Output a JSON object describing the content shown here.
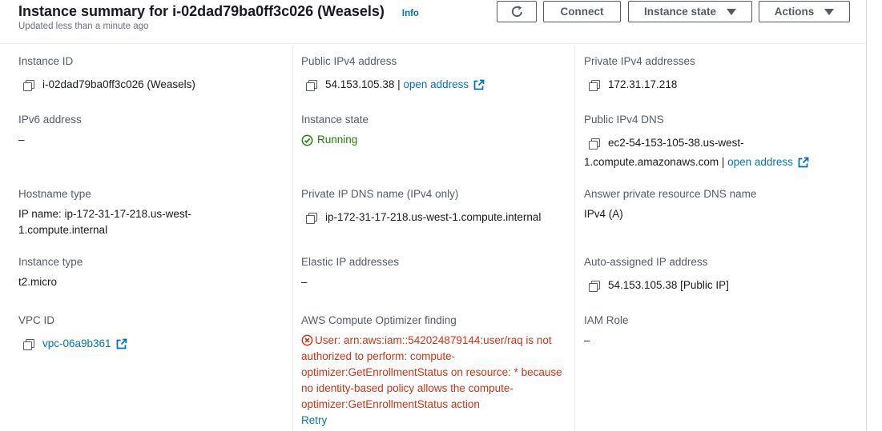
{
  "header": {
    "title": "Instance summary for i-02dad79ba0ff3c026 (Weasels)",
    "info": "Info",
    "subtitle": "Updated less than a minute ago",
    "buttons": {
      "connect": "Connect",
      "instance_state": "Instance state",
      "actions": "Actions"
    }
  },
  "fields": {
    "instance_id": {
      "label": "Instance ID",
      "value": "i-02dad79ba0ff3c026 (Weasels)"
    },
    "public_ipv4": {
      "label": "Public IPv4 address",
      "value": "54.153.105.38",
      "separator": " | ",
      "link": "open address"
    },
    "private_ipv4": {
      "label": "Private IPv4 addresses",
      "value": "172.31.17.218"
    },
    "ipv6": {
      "label": "IPv6 address",
      "value": "–"
    },
    "instance_state": {
      "label": "Instance state",
      "value": "Running"
    },
    "public_dns": {
      "label": "Public IPv4 DNS",
      "value_line1": "ec2-54-153-105-38.us-west-",
      "value_line2": "1.compute.amazonaws.com",
      "separator": " | ",
      "link": "open address"
    },
    "hostname_type": {
      "label": "Hostname type",
      "value": "IP name: ip-172-31-17-218.us-west-1.compute.internal"
    },
    "private_dns": {
      "label": "Private IP DNS name (IPv4 only)",
      "value": "ip-172-31-17-218.us-west-1.compute.internal"
    },
    "answer_dns": {
      "label": "Answer private resource DNS name",
      "value": "IPv4 (A)"
    },
    "instance_type": {
      "label": "Instance type",
      "value": "t2.micro"
    },
    "elastic_ip": {
      "label": "Elastic IP addresses",
      "value": "–"
    },
    "auto_ip": {
      "label": "Auto-assigned IP address",
      "value": "54.153.105.38 [Public IP]"
    },
    "vpc_id": {
      "label": "VPC ID",
      "value": "vpc-06a9b361"
    },
    "optimizer": {
      "label": "AWS Compute Optimizer finding",
      "error": "User: arn:aws:iam::542024879144:user/raq is not authorized to perform: compute-optimizer:GetEnrollmentStatus on resource: * because no identity-based policy allows the compute-optimizer:GetEnrollmentStatus action",
      "retry": "Retry"
    },
    "iam_role": {
      "label": "IAM Role",
      "value": "–"
    }
  },
  "colors": {
    "link": "#0073bb",
    "success": "#1d8102",
    "error": "#d13212",
    "label": "#545b64"
  },
  "icons": [
    "refresh-icon",
    "copy-icon",
    "external-link-icon",
    "check-circle-icon",
    "error-circle-icon",
    "caret-down-icon"
  ]
}
